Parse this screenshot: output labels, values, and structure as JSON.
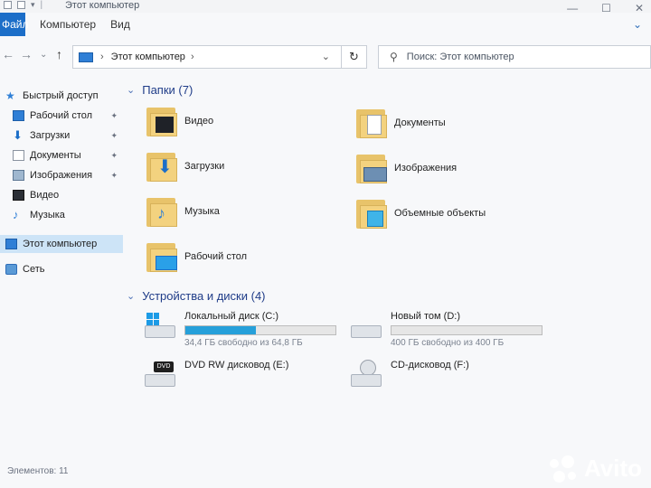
{
  "window": {
    "title": "Этот компьютер",
    "controls": [
      "minimize-icon",
      "maximize-icon",
      "close-icon"
    ]
  },
  "ribbon": {
    "tabs": [
      "Файл",
      "Компьютер",
      "Вид"
    ]
  },
  "address": {
    "path": "Этот компьютер",
    "refresh_icon": "refresh-icon"
  },
  "search": {
    "placeholder": "Поиск: Этот компьютер"
  },
  "sidebar": {
    "items": [
      {
        "label": "Быстрый доступ",
        "icon": "star-icon",
        "pinned": false,
        "selected": false
      },
      {
        "label": "Рабочий стол",
        "icon": "desktop-icon",
        "pinned": true,
        "selected": false
      },
      {
        "label": "Загрузки",
        "icon": "download-icon",
        "pinned": true,
        "selected": false
      },
      {
        "label": "Документы",
        "icon": "documents-icon",
        "pinned": true,
        "selected": false
      },
      {
        "label": "Изображения",
        "icon": "pictures-icon",
        "pinned": true,
        "selected": false
      },
      {
        "label": "Видео",
        "icon": "video-icon",
        "pinned": false,
        "selected": false
      },
      {
        "label": "Музыка",
        "icon": "music-icon",
        "pinned": false,
        "selected": false
      },
      {
        "label": "Этот компьютер",
        "icon": "computer-icon",
        "pinned": false,
        "selected": true
      },
      {
        "label": "Сеть",
        "icon": "network-icon",
        "pinned": false,
        "selected": false
      }
    ]
  },
  "folders_group": {
    "heading": "Папки (7)",
    "items": [
      {
        "label": "Видео",
        "icon": "video-folder-icon"
      },
      {
        "label": "Документы",
        "icon": "documents-folder-icon"
      },
      {
        "label": "Загрузки",
        "icon": "downloads-folder-icon"
      },
      {
        "label": "Изображения",
        "icon": "pictures-folder-icon"
      },
      {
        "label": "Музыка",
        "icon": "music-folder-icon"
      },
      {
        "label": "Объемные объекты",
        "icon": "3d-objects-folder-icon"
      },
      {
        "label": "Рабочий стол",
        "icon": "desktop-folder-icon"
      }
    ]
  },
  "devices_group": {
    "heading": "Устройства и диски (4)",
    "items": [
      {
        "name": "Локальный диск (C:)",
        "free_text": "34,4 ГБ свободно из 64,8 ГБ",
        "used_fraction": 0.47,
        "icon": "windows-drive-icon"
      },
      {
        "name": "Новый том (D:)",
        "free_text": "400 ГБ свободно из 400 ГБ",
        "used_fraction": 0.0,
        "icon": "hard-drive-icon"
      },
      {
        "name": "DVD RW дисковод (E:)",
        "icon": "dvd-drive-icon"
      },
      {
        "name": "CD-дисковод (F:)",
        "icon": "cd-drive-icon"
      }
    ]
  },
  "status": {
    "items_count": "Элементов: 11"
  },
  "watermark": {
    "text": "Avito"
  },
  "colors": {
    "accent": "#1c6ec8",
    "usage_bar": "#26a0da",
    "selection": "#cde4f7",
    "group_heading": "#1f3c88"
  }
}
